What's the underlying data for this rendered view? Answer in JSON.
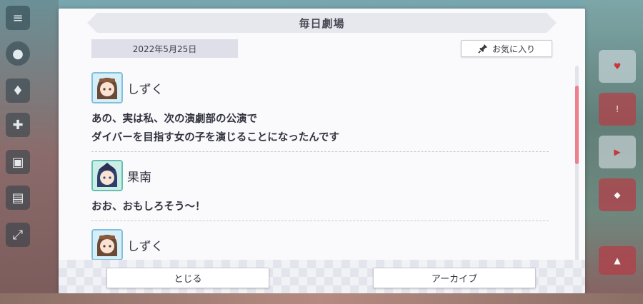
{
  "modal": {
    "title": "毎日劇場",
    "date": "2022年5月25日",
    "favorite_label": "お気に入り"
  },
  "messages": [
    {
      "speaker": "しずく",
      "lines": [
        "あの、実は私、次の演劇部の公演で",
        "ダイバーを目指す女の子を演じることになったんです"
      ]
    },
    {
      "speaker": "果南",
      "lines": [
        "おお、おもしろそう～！"
      ]
    },
    {
      "speaker": "しずく",
      "lines": []
    }
  ],
  "footer": {
    "close_label": "とじる",
    "archive_label": "アーカイブ"
  },
  "scroll": {
    "position_fraction": 0.17,
    "visible_fraction": 0.4
  },
  "colors": {
    "accent": "#ee7f8c",
    "title_bar": "#e7e8ee",
    "date_badge": "#dedfe8",
    "text": "#333340"
  },
  "icons": {
    "menu": "hamburger-icon",
    "favorite": "pin-icon"
  }
}
